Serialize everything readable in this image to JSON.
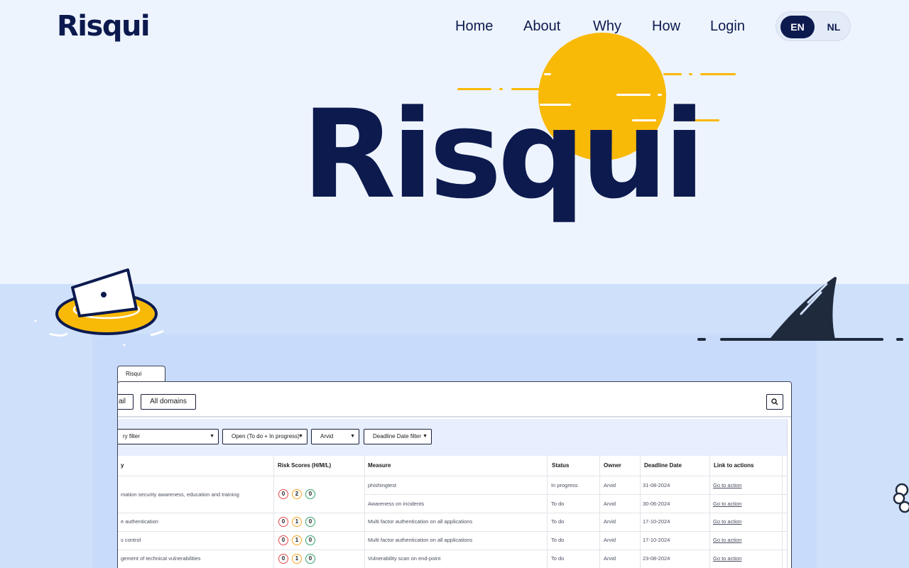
{
  "brand": {
    "name": "Risqui",
    "hero_name": "Risqui"
  },
  "nav": {
    "items": [
      "Home",
      "About",
      "Why",
      "How",
      "Login"
    ]
  },
  "lang": {
    "active": "EN",
    "other": "NL"
  },
  "colors": {
    "navy": "#0c1a4e",
    "sun": "#f9b907",
    "sky": "#eef4fd",
    "sea": "#cfe0fb"
  },
  "app": {
    "tab_label": "Risqui",
    "toolbar": {
      "partial_button": "ail",
      "all_domains_button": "All domains",
      "search_icon": "search-icon"
    },
    "filters": {
      "category": "ry filter",
      "status": "Open (To do + In progress)",
      "owner": "Arvid",
      "deadline": "Deadline Date filter"
    },
    "columns": [
      "y",
      "Risk Scores (H/M/L)",
      "Measure",
      "Status",
      "Owner",
      "Deadline Date",
      "Link to actions"
    ],
    "rows": [
      {
        "category": "mation security awareness, education and training",
        "scores": [
          "0",
          "2",
          "0"
        ],
        "measures": [
          {
            "measure": "phishingtest",
            "status": "In progress",
            "owner": "Arvid",
            "deadline": "31-08-2024",
            "link": "Go to action"
          },
          {
            "measure": "Awareness on incidents",
            "status": "To do",
            "owner": "Arvid",
            "deadline": "30-06-2024",
            "link": "Go to action"
          }
        ]
      },
      {
        "category": "e authentication",
        "scores": [
          "0",
          "1",
          "0"
        ],
        "measures": [
          {
            "measure": "Multi factor authentication on all applications",
            "status": "To do",
            "owner": "Arvid",
            "deadline": "17-10-2024",
            "link": "Go to action"
          }
        ]
      },
      {
        "category": "s control",
        "scores": [
          "0",
          "1",
          "0"
        ],
        "measures": [
          {
            "measure": "Multi factor authentication on all applications",
            "status": "To do",
            "owner": "Arvid",
            "deadline": "17-10-2024",
            "link": "Go to action"
          }
        ]
      },
      {
        "category": "gement of technical vulnerabilities",
        "scores": [
          "0",
          "1",
          "0"
        ],
        "measures": [
          {
            "measure": "Vulnerability scan on end-point",
            "status": "To do",
            "owner": "Arvid",
            "deadline": "23-08-2024",
            "link": "Go to action"
          }
        ]
      }
    ]
  }
}
